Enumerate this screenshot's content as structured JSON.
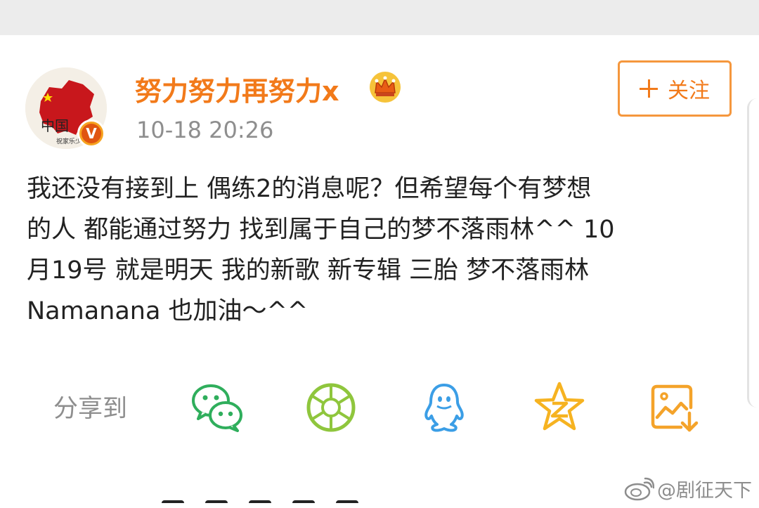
{
  "user": {
    "name": "努力努力再努力x",
    "timestamp": "10-18 20:26",
    "avatar_text": "中国",
    "avatar_subtext": "祝家乐少",
    "verified_mark": "V"
  },
  "follow_button": {
    "label": "关注"
  },
  "post": {
    "lines": [
      "我还没有接到上 偶练2的消息呢？但希望每个有梦想",
      "的人 都能通过努力 找到属于自己的梦不落雨林^^ 10",
      "月19号 就是明天 我的新歌 新专辑 三胎 梦不落雨林",
      "Namanana 也加油～^^"
    ]
  },
  "share": {
    "label": "分享到",
    "targets": [
      "wechat-icon",
      "moments-icon",
      "qq-icon",
      "qzone-icon",
      "save-image-icon"
    ]
  },
  "watermark": {
    "text": "@剧征天下"
  },
  "colors": {
    "accent": "#f27a1a",
    "meta_text": "#8e8e8e",
    "body_text": "#222222",
    "wechat": "#2fae5c",
    "moments": "#8fc63d",
    "qq": "#3b9ee6",
    "qzone": "#f6b321",
    "save": "#f4a32a"
  }
}
